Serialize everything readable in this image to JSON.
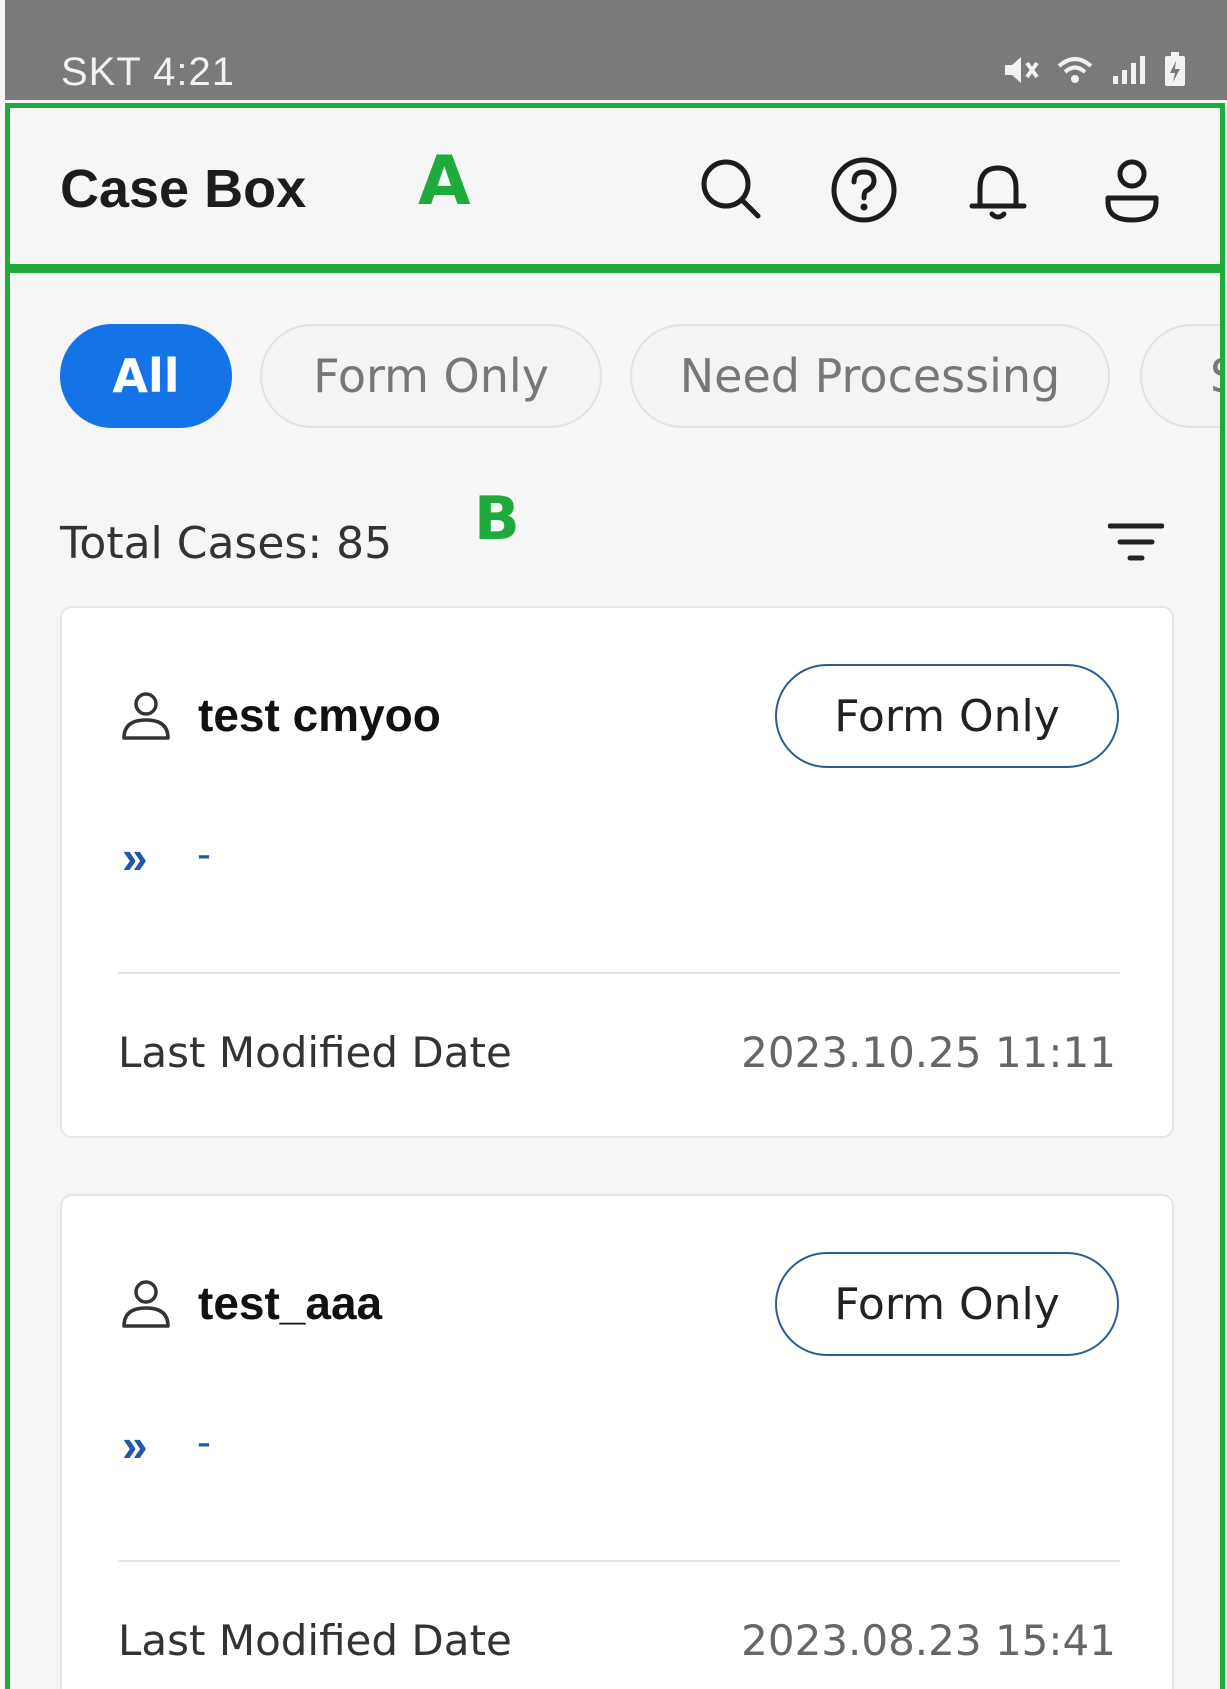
{
  "status_bar": {
    "carrier_time": "SKT 4:21"
  },
  "annotations": {
    "label_a": "A",
    "label_b": "B",
    "color": "#1faa3c"
  },
  "app_bar": {
    "title": "Case Box",
    "icons": [
      "search-icon",
      "help-icon",
      "bell-icon",
      "profile-icon"
    ]
  },
  "filters": {
    "chips": [
      {
        "label": "All",
        "active": true
      },
      {
        "label": "Form Only",
        "active": false
      },
      {
        "label": "Need Processing",
        "active": false
      },
      {
        "label": "S",
        "active": false
      }
    ],
    "accent": "#1573e8"
  },
  "summary": {
    "total_cases": "Total Cases: 85"
  },
  "cases": [
    {
      "name": "test cmyoo",
      "badge": "Form Only",
      "chevron": "»",
      "detail": "-",
      "date_label": "Last Modified Date",
      "date_value": "2023.10.25 11:11"
    },
    {
      "name": "test_aaa",
      "badge": "Form Only",
      "chevron": "»",
      "detail": "-",
      "date_label": "Last Modified Date",
      "date_value": "2023.08.23 15:41"
    }
  ]
}
